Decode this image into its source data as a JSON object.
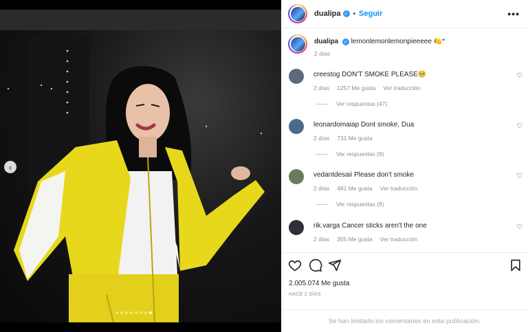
{
  "post": {
    "username": "dualipa",
    "follow_label": "Seguir",
    "separator": "•",
    "verified_glyph": "✓",
    "more_label": "•••",
    "caption_text": "lemonlemonlemonpieeeee 🍋*",
    "caption_time": "2 días",
    "likes": "2.005.074 Me gusta",
    "posted_ago": "HACE 2 DÍAS",
    "comments_limited": "Se han limitado los comentarios en esta publicación."
  },
  "comments": [
    {
      "user": "creestog",
      "text": "DON'T SMOKE PLEASE🥺",
      "time": "2 días",
      "likes": "1257 Me gusta",
      "translate": "Ver traducción",
      "replies": "Ver respuestas (47)",
      "avatar_color": "#5b6b7b"
    },
    {
      "user": "leonardomaiap",
      "text": "Dont smoke, Dua",
      "time": "2 días",
      "likes": "731 Me gusta",
      "translate": "",
      "replies": "Ver respuestas (9)",
      "avatar_color": "#4a6a8a"
    },
    {
      "user": "vedantdesaii",
      "text": "Please don't smoke",
      "time": "2 días",
      "likes": "481 Me gusta",
      "translate": "Ver traducción",
      "replies": "Ver respuestas (8)",
      "avatar_color": "#6b7b5b"
    },
    {
      "user": "rik.varga",
      "text": "Cancer sticks aren't the one",
      "time": "2 días",
      "likes": "355 Me gusta",
      "translate": "Ver traducción",
      "replies": "",
      "avatar_color": "#2f2f3a"
    }
  ],
  "carousel": {
    "prev_glyph": "‹",
    "dot_count": 8,
    "active_dot": 7
  },
  "icons": {
    "like": "heart-icon",
    "comment": "comment-icon",
    "share": "share-icon",
    "save": "bookmark-icon",
    "comment_like": "small-heart-icon"
  },
  "colors": {
    "link_blue": "#0095f6",
    "verified_blue": "#3897f0",
    "muted_text": "#8e8e8e",
    "jacket_yellow": "#e8d81c"
  }
}
